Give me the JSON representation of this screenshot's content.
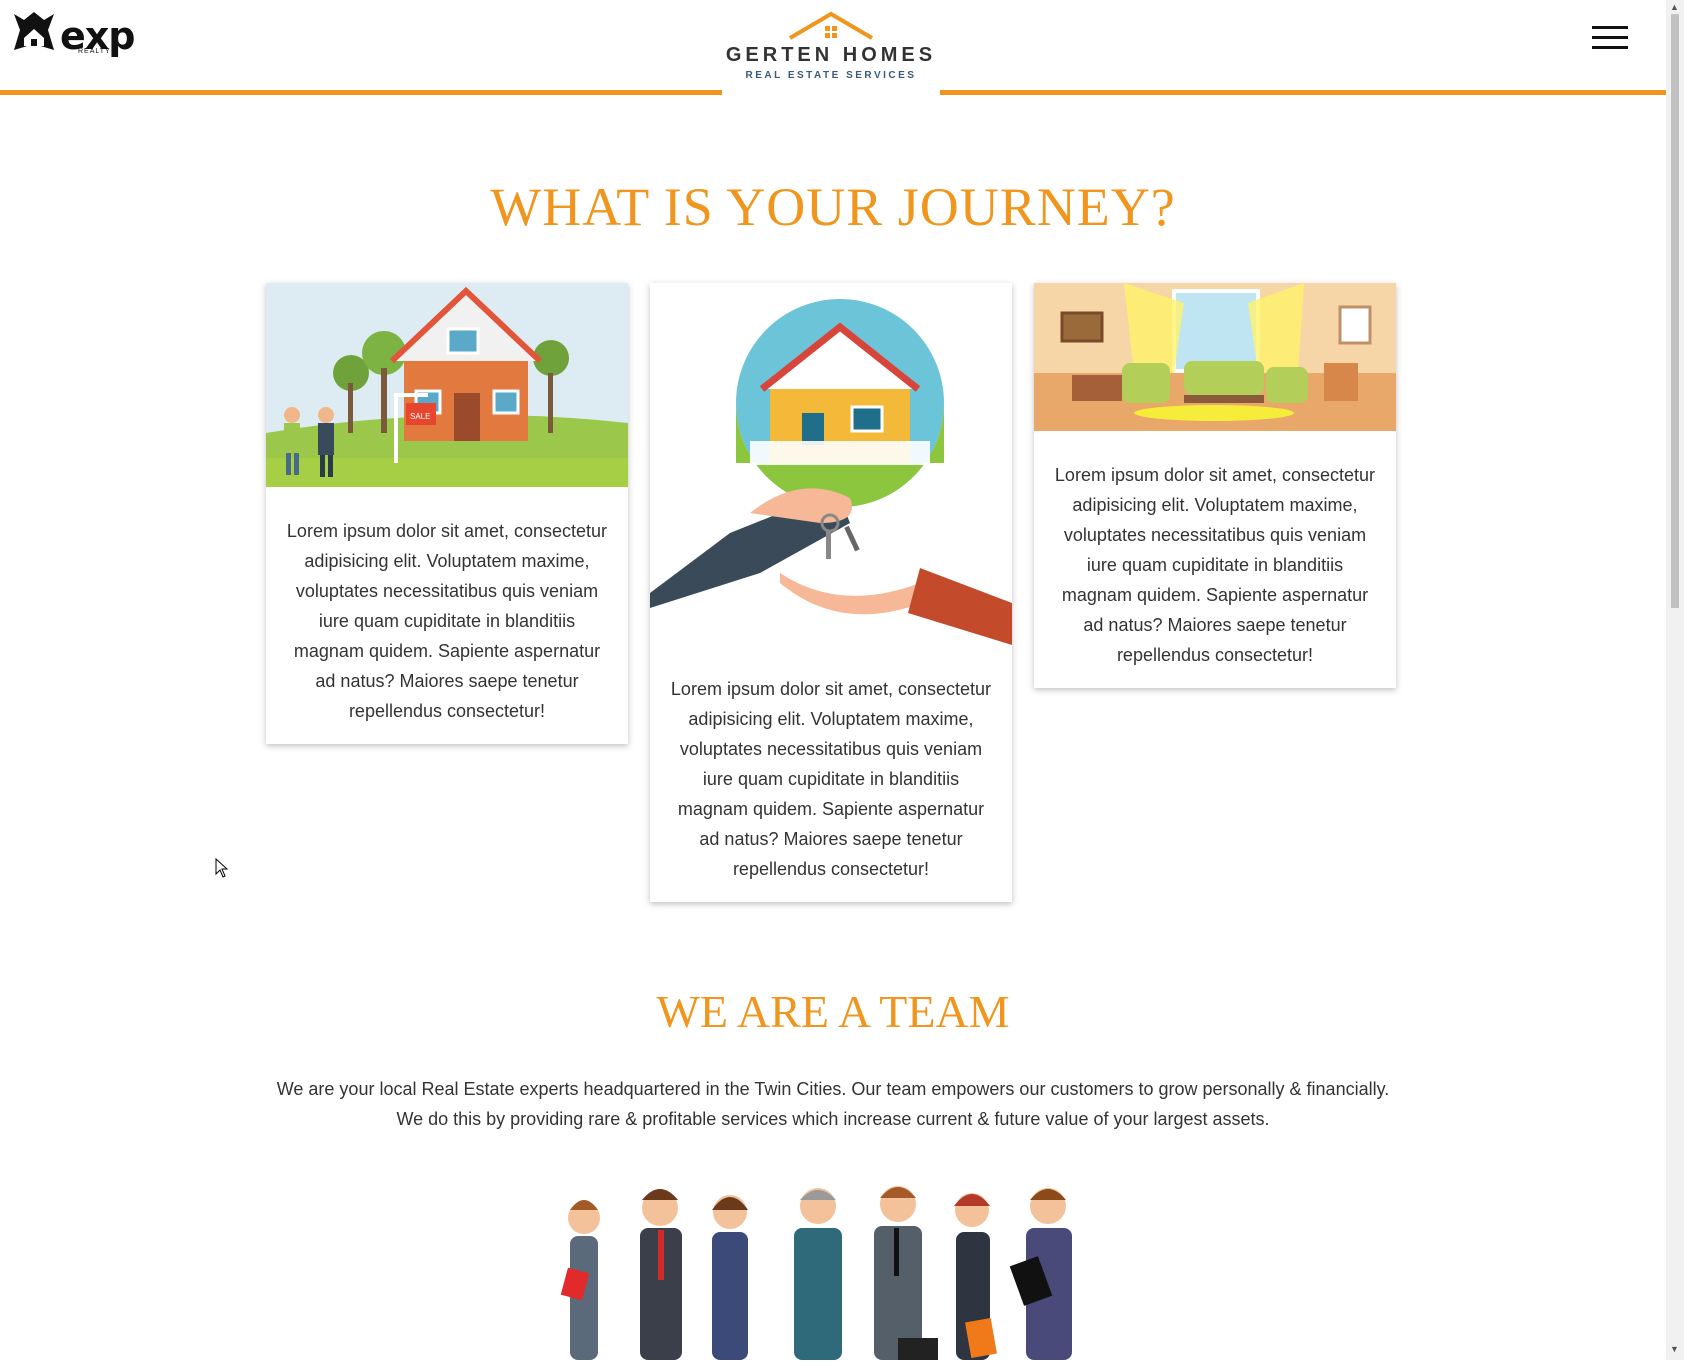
{
  "header": {
    "exp_logo_text": "exp",
    "exp_logo_sub": "REALTY",
    "brand_name": "GERTEN HOMES",
    "brand_sub": "REAL ESTATE SERVICES",
    "menu_icon": "hamburger-icon",
    "accent_color": "#f0961e"
  },
  "journey": {
    "title": "WHAT IS YOUR JOURNEY?",
    "cards": [
      {
        "image": "house-for-sale-illustration",
        "text": "Lorem ipsum dolor sit amet, consectetur adipisicing elit. Voluptatem maxime, voluptates necessitatibus quis veniam iure quam cupiditate in blanditiis magnam quidem. Sapiente aspernatur ad natus? Maiores saepe tenetur repellendus consectetur!"
      },
      {
        "image": "house-keys-handover-illustration",
        "text": "Lorem ipsum dolor sit amet, consectetur adipisicing elit. Voluptatem maxime, voluptates necessitatibus quis veniam iure quam cupiditate in blanditiis magnam quidem. Sapiente aspernatur ad natus? Maiores saepe tenetur repellendus consectetur!"
      },
      {
        "image": "living-room-illustration",
        "text": "Lorem ipsum dolor sit amet, consectetur adipisicing elit. Voluptatem maxime, voluptates necessitatibus quis veniam iure quam cupiditate in blanditiis magnam quidem. Sapiente aspernatur ad natus? Maiores saepe tenetur repellendus consectetur!"
      }
    ]
  },
  "team": {
    "title": "WE ARE A TEAM",
    "description": "We are your local Real Estate experts headquartered in the Twin Cities. Our team empowers our customers to grow personally & financially. We do this by providing rare & profitable services which increase current & future value of your largest assets.",
    "image": "business-team-illustration"
  }
}
